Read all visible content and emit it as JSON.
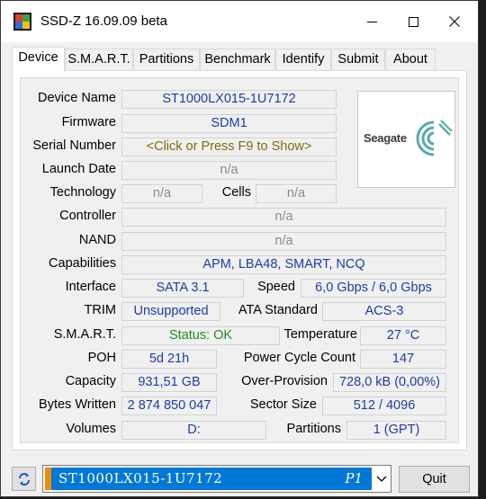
{
  "window": {
    "title": "SSD-Z 16.09.09 beta"
  },
  "tabs": [
    "Device",
    "S.M.A.R.T.",
    "Partitions",
    "Benchmark",
    "Identify",
    "Submit",
    "About"
  ],
  "device": {
    "labels": {
      "device_name": "Device Name",
      "firmware": "Firmware",
      "serial_number": "Serial Number",
      "launch_date": "Launch Date",
      "technology": "Technology",
      "cells": "Cells",
      "controller": "Controller",
      "nand": "NAND",
      "capabilities": "Capabilities",
      "interface": "Interface",
      "speed": "Speed",
      "trim": "TRIM",
      "ata_standard": "ATA Standard",
      "smart": "S.M.A.R.T.",
      "temperature": "Temperature",
      "poh": "POH",
      "power_cycle_count": "Power Cycle Count",
      "capacity": "Capacity",
      "over_provision": "Over-Provision",
      "bytes_written": "Bytes Written",
      "sector_size": "Sector Size",
      "volumes": "Volumes",
      "partitions": "Partitions"
    },
    "values": {
      "device_name": "ST1000LX015-1U7172",
      "firmware": "SDM1",
      "serial_number": "<Click or Press F9 to Show>",
      "launch_date": "n/a",
      "technology": "n/a",
      "cells": "n/a",
      "controller": "n/a",
      "nand": "n/a",
      "capabilities": "APM, LBA48, SMART, NCQ",
      "interface": "SATA 3.1",
      "speed": "6,0 Gbps / 6,0 Gbps",
      "trim": "Unsupported",
      "ata_standard": "ACS-3",
      "smart": "Status: OK",
      "temperature": "27 °C",
      "poh": "5d 21h",
      "power_cycle_count": "147",
      "capacity": "931,51 GB",
      "over_provision": "728,0 kB (0,00%)",
      "bytes_written": "2 874 850 047",
      "sector_size": "512 / 4096",
      "volumes": "D:",
      "partitions": "1 (GPT)"
    },
    "logo": {
      "text": "Seagate",
      "icon": "seagate-logo-icon"
    }
  },
  "bottom": {
    "drive_select": {
      "value": "ST1000LX015-1U7172",
      "tag": "P1"
    },
    "quit_label": "Quit",
    "refresh_icon": "refresh-icon"
  },
  "colors": {
    "value_blue": "#1d3ca8",
    "value_grey": "#8b8b8b",
    "value_gold": "#826a0c",
    "value_green": "#1f8a1f",
    "selection": "#0078d7",
    "drive_stripe": "#f08a00"
  }
}
